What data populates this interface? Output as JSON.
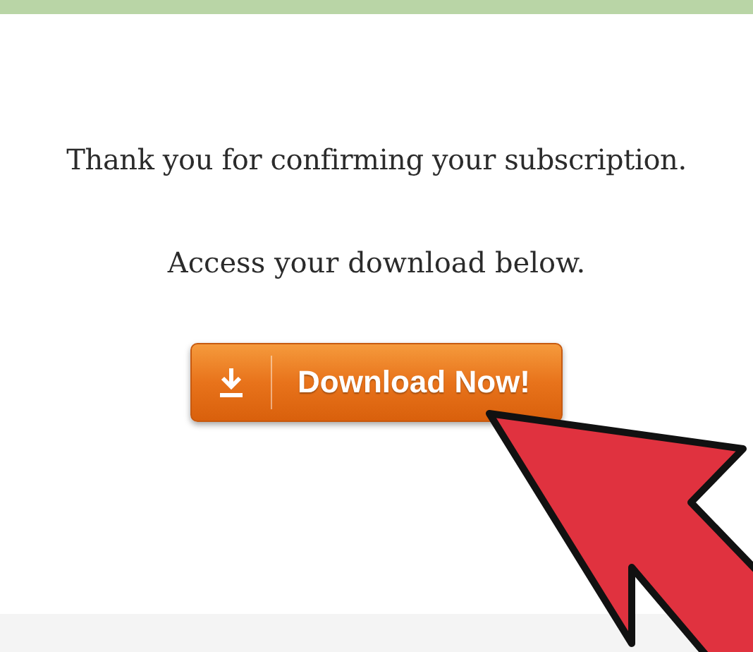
{
  "message": "Thank you for confirming your subscription.",
  "instruction": "Access your download below.",
  "button": {
    "label": "Download Now!"
  }
}
